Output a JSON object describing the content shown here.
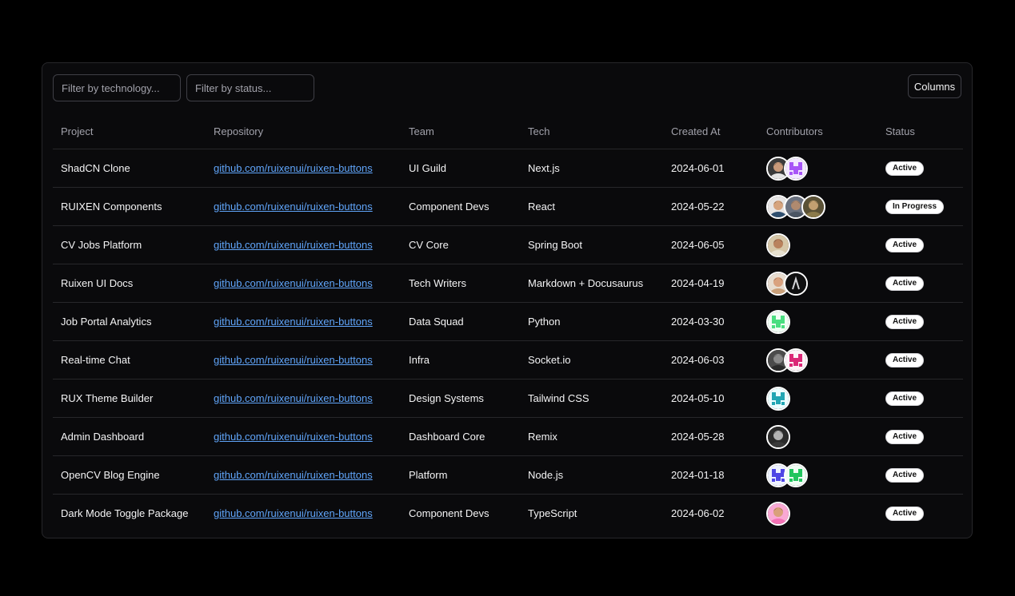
{
  "filters": {
    "technology_placeholder": "Filter by technology...",
    "status_placeholder": "Filter by status..."
  },
  "columns_button": "Columns",
  "headers": {
    "project": "Project",
    "repository": "Repository",
    "team": "Team",
    "tech": "Tech",
    "created_at": "Created At",
    "contributors": "Contributors",
    "status": "Status"
  },
  "rows": [
    {
      "project": "ShadCN Clone",
      "repository": "github.com/ruixenui/ruixen-buttons",
      "team": "UI Guild",
      "tech": "Next.js",
      "created_at": "2024-06-01",
      "status": "Active",
      "contributors": [
        {
          "kind": "photo",
          "bg": "#3b3b3b",
          "skin": "#c99a7a",
          "hair": "#1a1a1a",
          "shirt": "#e5e5e5"
        },
        {
          "kind": "pixel",
          "bg": "#f3e8ff",
          "fg": "#a855f7"
        }
      ]
    },
    {
      "project": "RUIXEN Components",
      "repository": "github.com/ruixenui/ruixen-buttons",
      "team": "Component Devs",
      "tech": "React",
      "created_at": "2024-05-22",
      "status": "In Progress",
      "contributors": [
        {
          "kind": "photo",
          "bg": "#e7e5e4",
          "skin": "#d6a47e",
          "hair": "#2b2116",
          "shirt": "#2f4f6f"
        },
        {
          "kind": "photo",
          "bg": "#6b7280",
          "skin": "#b08a6f",
          "hair": "#3a3a3a",
          "shirt": "#4b5563"
        },
        {
          "kind": "photo",
          "bg": "#5b5236",
          "skin": "#c2a071",
          "hair": "#3f3520",
          "shirt": "#8b7a4a"
        }
      ]
    },
    {
      "project": "CV Jobs Platform",
      "repository": "github.com/ruixenui/ruixen-buttons",
      "team": "CV Core",
      "tech": "Spring Boot",
      "created_at": "2024-06-05",
      "status": "Active",
      "contributors": [
        {
          "kind": "photo",
          "bg": "#d6c7a8",
          "skin": "#b9825d",
          "hair": "#1c1c1c",
          "shirt": "#e8e1d0"
        }
      ]
    },
    {
      "project": "Ruixen UI Docs",
      "repository": "github.com/ruixenui/ruixen-buttons",
      "team": "Tech Writers",
      "tech": "Markdown + Docusaurus",
      "created_at": "2024-04-19",
      "status": "Active",
      "contributors": [
        {
          "kind": "photo",
          "bg": "#e7dccf",
          "skin": "#d9a27f",
          "hair": "#4a2c1a",
          "shirt": "#caa07a"
        },
        {
          "kind": "logo",
          "bg": "#0f0f10",
          "fg": "#d4d4d8"
        }
      ]
    },
    {
      "project": "Job Portal Analytics",
      "repository": "github.com/ruixenui/ruixen-buttons",
      "team": "Data Squad",
      "tech": "Python",
      "created_at": "2024-03-30",
      "status": "Active",
      "contributors": [
        {
          "kind": "pixel",
          "bg": "#f0fdf4",
          "fg": "#4ade80"
        }
      ]
    },
    {
      "project": "Real-time Chat",
      "repository": "github.com/ruixenui/ruixen-buttons",
      "team": "Infra",
      "tech": "Socket.io",
      "created_at": "2024-06-03",
      "status": "Active",
      "contributors": [
        {
          "kind": "photo",
          "bg": "#4b4b4b",
          "skin": "#8a8a8a",
          "hair": "#1f1f1f",
          "shirt": "#2a2a2a"
        },
        {
          "kind": "pixel",
          "bg": "#fdf2f8",
          "fg": "#db2777"
        }
      ]
    },
    {
      "project": "RUX Theme Builder",
      "repository": "github.com/ruixenui/ruixen-buttons",
      "team": "Design Systems",
      "tech": "Tailwind CSS",
      "created_at": "2024-05-10",
      "status": "Active",
      "contributors": [
        {
          "kind": "pixel",
          "bg": "#ecfeff",
          "fg": "#22a6b3"
        }
      ]
    },
    {
      "project": "Admin Dashboard",
      "repository": "github.com/ruixenui/ruixen-buttons",
      "team": "Dashboard Core",
      "tech": "Remix",
      "created_at": "2024-05-28",
      "status": "Active",
      "contributors": [
        {
          "kind": "photo",
          "bg": "#2b2b2b",
          "skin": "#b3b3b3",
          "hair": "#111111",
          "shirt": "#3a3a3a"
        }
      ]
    },
    {
      "project": "OpenCV Blog Engine",
      "repository": "github.com/ruixenui/ruixen-buttons",
      "team": "Platform",
      "tech": "Node.js",
      "created_at": "2024-01-18",
      "status": "Active",
      "contributors": [
        {
          "kind": "pixel",
          "bg": "#eef2ff",
          "fg": "#4f46e5"
        },
        {
          "kind": "pixel",
          "bg": "#f0fdf4",
          "fg": "#22c55e"
        }
      ]
    },
    {
      "project": "Dark Mode Toggle Package",
      "repository": "github.com/ruixenui/ruixen-buttons",
      "team": "Component Devs",
      "tech": "TypeScript",
      "created_at": "2024-06-02",
      "status": "Active",
      "contributors": [
        {
          "kind": "photo",
          "bg": "#f9a8d4",
          "skin": "#d9a07a",
          "hair": "#5a2e1a",
          "shirt": "#f472b6"
        }
      ]
    }
  ]
}
